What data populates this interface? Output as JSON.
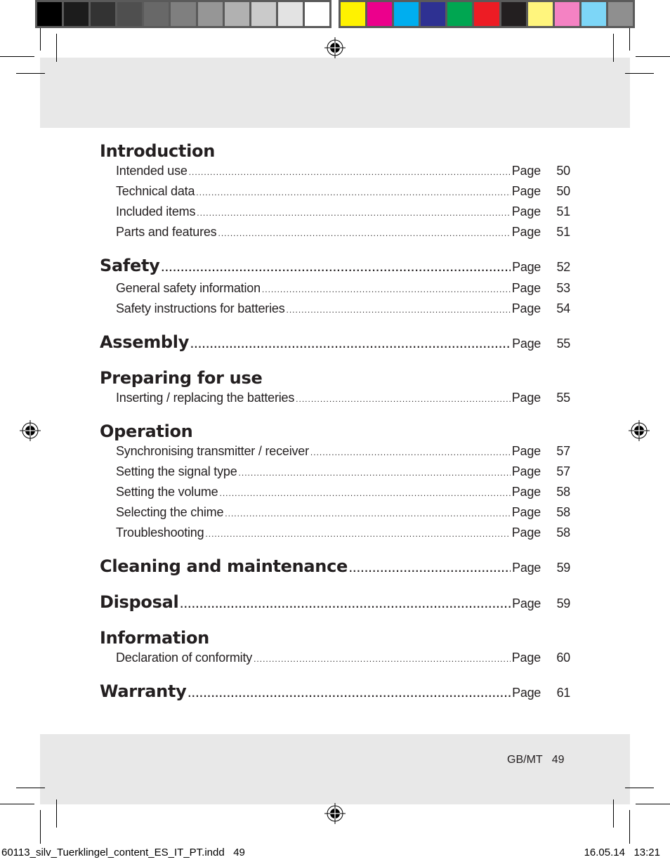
{
  "color_bars": {
    "grayscale": [
      "#000000",
      "#1c1c1c",
      "#333333",
      "#4f4f4f",
      "#686868",
      "#7f7f7f",
      "#969696",
      "#b1b1b1",
      "#cacaca",
      "#e3e3e3",
      "#ffffff"
    ],
    "colors": [
      "#fff200",
      "#ec008c",
      "#00aeef",
      "#2e3192",
      "#00a651",
      "#ed1c24",
      "#231f20",
      "#fff57d",
      "#f482c3",
      "#7dd6f7",
      "#8f8f8f"
    ]
  },
  "toc": {
    "page_label": "Page",
    "sections": [
      {
        "title": "Introduction",
        "page": null,
        "items": [
          {
            "label": "Intended use",
            "page": "50"
          },
          {
            "label": "Technical data",
            "page": "50"
          },
          {
            "label": "Included items",
            "page": "51"
          },
          {
            "label": "Parts and features",
            "page": "51"
          }
        ]
      },
      {
        "title": "Safety",
        "page": "52",
        "items": [
          {
            "label": "General safety information",
            "page": "53"
          },
          {
            "label": "Safety instructions for batteries",
            "page": "54"
          }
        ]
      },
      {
        "title": "Assembly",
        "page": "55",
        "items": []
      },
      {
        "title": "Preparing for use",
        "page": null,
        "items": [
          {
            "label": "Inserting / replacing the batteries",
            "page": "55"
          }
        ]
      },
      {
        "title": "Operation",
        "page": null,
        "items": [
          {
            "label": "Synchronising transmitter / receiver",
            "page": "57"
          },
          {
            "label": "Setting the signal type",
            "page": "57"
          },
          {
            "label": "Setting the volume",
            "page": "58"
          },
          {
            "label": "Selecting the chime",
            "page": "58"
          },
          {
            "label": "Troubleshooting",
            "page": "58"
          }
        ]
      },
      {
        "title": "Cleaning and maintenance",
        "page": "59",
        "items": []
      },
      {
        "title": "Disposal",
        "page": "59",
        "items": []
      },
      {
        "title": "Information",
        "page": null,
        "items": [
          {
            "label": "Declaration of conformity",
            "page": "60"
          }
        ]
      },
      {
        "title": "Warranty",
        "page": "61",
        "items": []
      }
    ]
  },
  "footer": {
    "page_marker": "GB/MT   49"
  },
  "slug": {
    "filename": "60113_silv_Tuerklingel_content_ES_IT_PT.indd   49",
    "datetime": "16.05.14   13:21"
  }
}
